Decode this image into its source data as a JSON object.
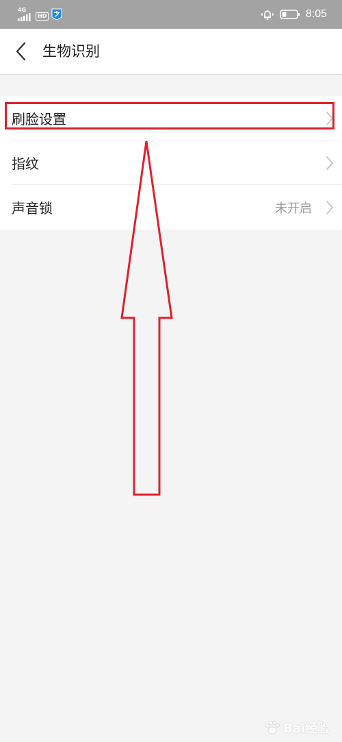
{
  "status_bar": {
    "network": "4G",
    "hd_label": "HD",
    "time": "8:05",
    "background_color": "#a3a3a3"
  },
  "title_bar": {
    "title": "生物识别",
    "back_icon": "chevron-left-icon"
  },
  "settings": {
    "items": [
      {
        "label": "刷脸设置",
        "value": "",
        "icon": "chevron-right-icon"
      },
      {
        "label": "指纹",
        "value": "",
        "icon": "chevron-right-icon"
      },
      {
        "label": "声音锁",
        "value": "未开启",
        "icon": "chevron-right-icon"
      }
    ]
  },
  "annotation": {
    "highlight_color": "#e0202d",
    "arrow_color": "#e0202d"
  },
  "watermark": {
    "text": "Bai经验"
  }
}
